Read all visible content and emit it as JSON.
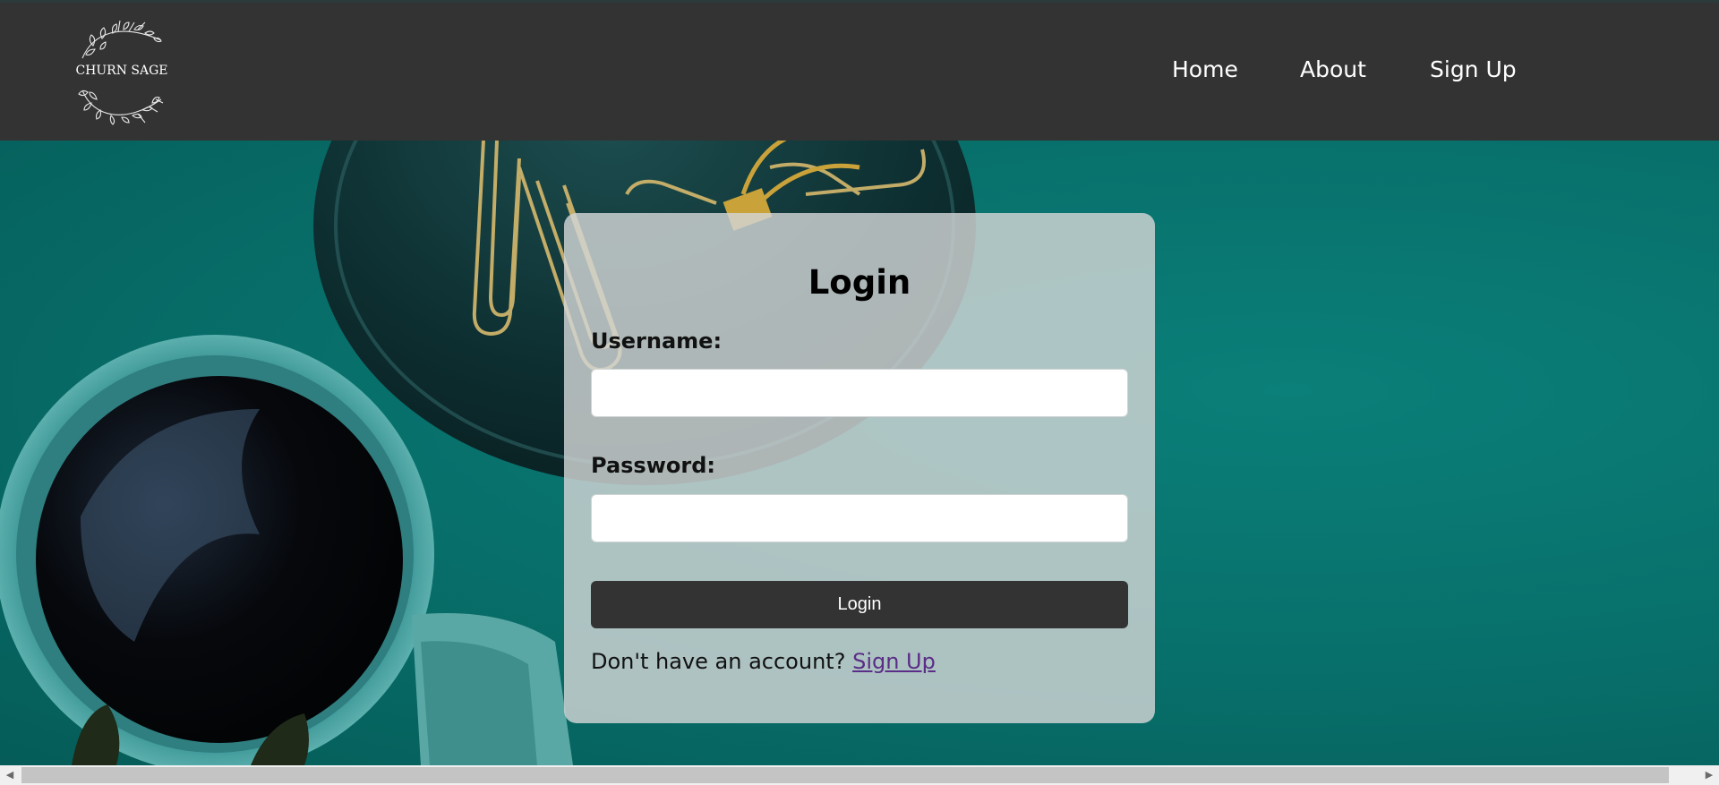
{
  "header": {
    "logo_text": "CHURN SAGE",
    "nav": [
      {
        "label": "Home"
      },
      {
        "label": "About"
      },
      {
        "label": "Sign Up"
      }
    ]
  },
  "login": {
    "title": "Login",
    "username_label": "Username:",
    "username_value": "",
    "password_label": "Password:",
    "password_value": "",
    "button_label": "Login",
    "signup_prompt": "Don't have an account?",
    "signup_link": "Sign Up"
  },
  "colors": {
    "header_bg": "#333333",
    "background_teal": "#0a6e6a",
    "button_bg": "#333333",
    "link": "#5a2d86"
  },
  "icons": {
    "logo": "laurel-wreath-icon",
    "scroll_left": "chevron-left-icon",
    "scroll_right": "chevron-right-icon"
  }
}
